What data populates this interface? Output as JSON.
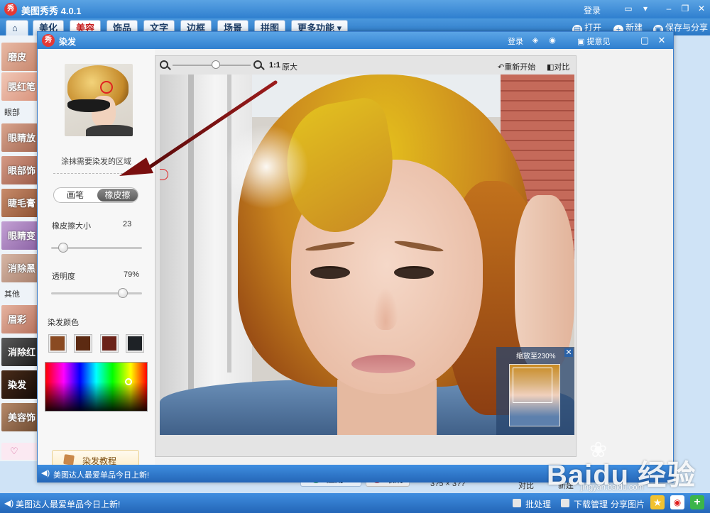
{
  "window": {
    "logo": "秀",
    "title": "美图秀秀 4.0.1",
    "login": "登录"
  },
  "tabs": [
    {
      "label": "美化"
    },
    {
      "label": "美容"
    },
    {
      "label": "饰品"
    },
    {
      "label": "文字"
    },
    {
      "label": "边框"
    },
    {
      "label": "场景"
    },
    {
      "label": "拼图"
    },
    {
      "label": "更多功能 ▾"
    }
  ],
  "toolbar": {
    "open": "打开",
    "new": "新建",
    "save": "保存与分享"
  },
  "sidebar": {
    "items": [
      "磨皮",
      "腮红笔",
      "眼睛放",
      "眼部饰",
      "睫毛膏",
      "眼睛变",
      "消除黑",
      "眉彩",
      "消除红",
      "染发",
      "美容饰"
    ],
    "headers": [
      "眼部",
      "其他"
    ]
  },
  "footer": {
    "notice": "美图达人最爱单品今日上新!",
    "batch": "批处理",
    "downloads": "下载管理",
    "share": "分享图片"
  },
  "under_strip": {
    "size_text": "3?5 × 3??",
    "compare": "对比",
    "new": "新建"
  },
  "dialog": {
    "logo": "秀",
    "title": "染发",
    "login": "登录",
    "feedback": "提意见",
    "thumb_caption": "涂抹需要染发的区域",
    "mode": {
      "brush": "画笔",
      "eraser": "橡皮擦",
      "active": "eraser"
    },
    "eraser_size": {
      "label": "橡皮擦大小",
      "value": "23",
      "level": 0.13
    },
    "opacity": {
      "label": "透明度",
      "value": "79%",
      "level": 0.79
    },
    "color_label": "染发颜色",
    "swatches": [
      "#8a4a22",
      "#5c2a12",
      "#6b2218",
      "#1e2226"
    ],
    "tutorial": "染发教程",
    "zoom": {
      "ratio": "1:1",
      "original": "原大",
      "level": 0.55
    },
    "restart": "重新开始",
    "compare": "对比",
    "navigator": {
      "title": "缩放至230%",
      "close": "✕"
    },
    "apply": "应用",
    "cancel": "取消",
    "status": "美图达人最爱单品今日上新!"
  },
  "watermark": {
    "text": "Baidu 经验",
    "url": "jingyan.baidu.com"
  },
  "colors": {
    "accent": "#2f7fcf",
    "active_tab": "#c61b1b",
    "arrow": "#7a0f0f"
  }
}
